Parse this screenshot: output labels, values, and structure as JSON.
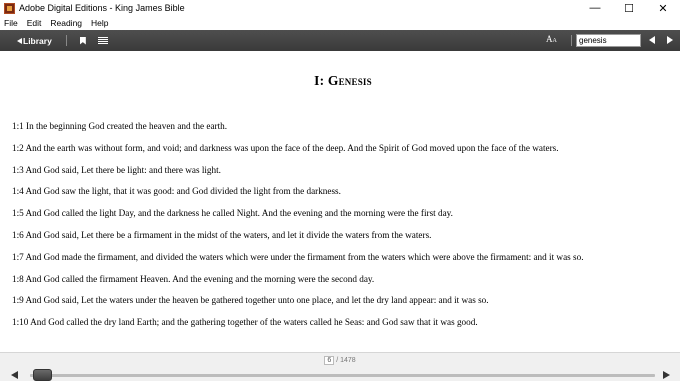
{
  "window": {
    "title": "Adobe Digital Editions - King James Bible",
    "minimize_glyph": "—",
    "maximize_glyph": "☐",
    "close_glyph": "✕"
  },
  "menu": [
    "File",
    "Edit",
    "Reading",
    "Help"
  ],
  "toolbar": {
    "library_label": "Library",
    "font_icon_label": "A",
    "font_icon_small": "A",
    "search_value": "genesis"
  },
  "content": {
    "chapter_title": "I: Genesis",
    "verses": [
      "1:1 In the beginning God created the heaven and the earth.",
      "1:2 And the earth was without form, and void; and darkness was upon the face of the deep. And the Spirit of God moved upon the face of the waters.",
      "1:3 And God said, Let there be light: and there was light.",
      "1:4 And God saw the light, that it was good: and God divided the light from the darkness.",
      "1:5 And God called the light Day, and the darkness he called Night. And the evening and the morning were the first day.",
      "1:6 And God said, Let there be a firmament in the midst of the waters, and let it divide the waters from the waters.",
      "1:7 And God made the firmament, and divided the waters which were under the firmament from the waters which were above the firmament: and it was so.",
      "1:8 And God called the firmament Heaven. And the evening and the morning were the second day.",
      "1:9 And God said, Let the waters under the heaven be gathered together unto one place, and let the dry land appear: and it was so.",
      "1:10 And God called the dry land Earth; and the gathering together of the waters called he Seas: and God saw that it was good."
    ]
  },
  "pagination": {
    "current_page": "6",
    "total_pages": "/ 1478",
    "progress_fraction": 0.0034
  }
}
